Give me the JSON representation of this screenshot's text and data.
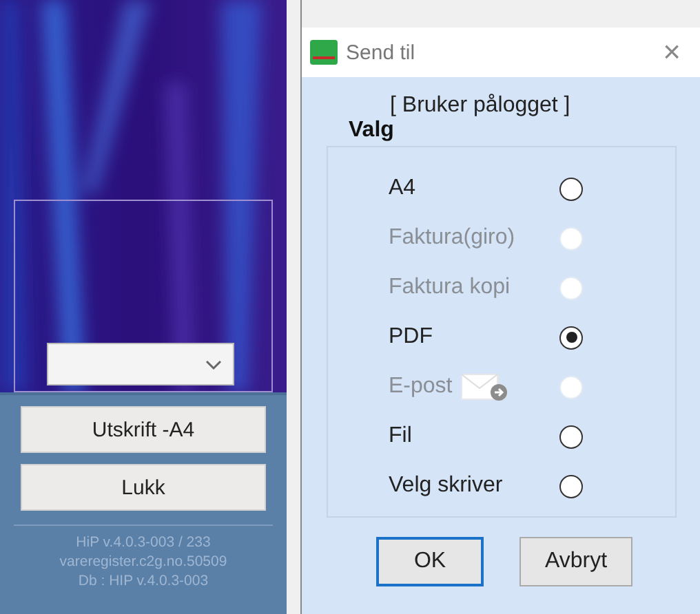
{
  "side_panel": {
    "dropdown": {
      "expanded": false
    },
    "buttons": [
      {
        "label": "Utskrift -A4"
      },
      {
        "label": "Lukk"
      }
    ],
    "version_lines": [
      "HiP v.4.0.3-003 / 233",
      "vareregister.c2g.no.50509",
      "Db : HIP v.4.0.3-003"
    ]
  },
  "dialog": {
    "title": "Send til",
    "close": "×",
    "user_status": "[ Bruker pålogget ]",
    "group_title": "Valg",
    "options": [
      {
        "label": "A4",
        "kind": "plain",
        "selected": false,
        "disabled": false
      },
      {
        "label": "Faktura(giro)",
        "kind": "plain",
        "selected": false,
        "disabled": true
      },
      {
        "label": "Faktura kopi",
        "kind": "plain",
        "selected": false,
        "disabled": true
      },
      {
        "label": "PDF",
        "kind": "plain",
        "selected": true,
        "disabled": false
      },
      {
        "label": "E-post",
        "kind": "email",
        "selected": false,
        "disabled": true
      },
      {
        "label": "Fil",
        "kind": "plain",
        "selected": false,
        "disabled": false
      },
      {
        "label": "Velg skriver",
        "kind": "plain",
        "selected": false,
        "disabled": false
      }
    ],
    "buttons": [
      {
        "label": "OK",
        "default": true
      },
      {
        "label": "Avbryt",
        "default": false
      }
    ]
  }
}
